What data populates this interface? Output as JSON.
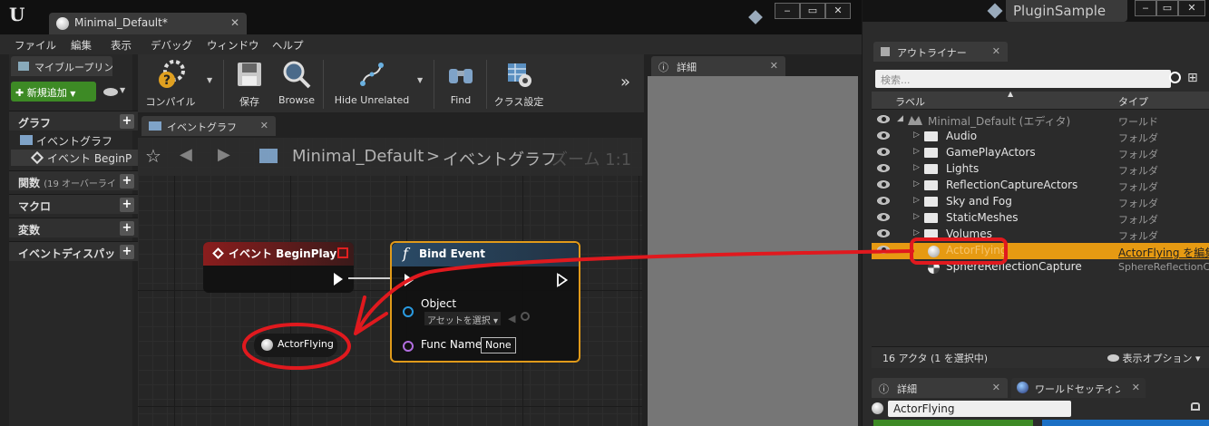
{
  "app": {
    "doc_tab": "Minimal_Default*",
    "project_name": "PluginSample",
    "window_controls": [
      "‒",
      "▭",
      "✕"
    ]
  },
  "menu": [
    "ファイル",
    "編集",
    "表示",
    "デバッグ",
    "ウィンドウ",
    "ヘルプ"
  ],
  "my_blueprint": {
    "tab": "マイブループリント",
    "add_button": "新規追加",
    "graph_section": "グラフ",
    "event_graph": "イベントグラフ",
    "event_beginplay": "イベント BeginP",
    "functions": "関数",
    "functions_note": "(19 オーバーライ",
    "macros": "マクロ",
    "variables": "変数",
    "dispatchers": "イベントディスパッ"
  },
  "toolbar": {
    "compile": "コンパイル",
    "save": "保存",
    "browse": "Browse",
    "hide_unrelated": "Hide Unrelated",
    "find": "Find",
    "class_settings": "クラス設定"
  },
  "graph": {
    "tab": "イベントグラフ",
    "breadcrumb_root": "Minimal_Default",
    "breadcrumb_sep": ">",
    "breadcrumb_current": "イベントグラフ",
    "zoom": "ズーム 1:1"
  },
  "details_left": {
    "tab": "詳細"
  },
  "nodes": {
    "begin_play": {
      "title": "イベント BeginPlay",
      "color": "#7a1a1a"
    },
    "bind_event": {
      "icon": "f",
      "title": "Bind Event",
      "object_label": "Object",
      "asset_select": "アセットを選択",
      "func_name_label": "Func Name",
      "func_name_value": "None",
      "color": "#2a4a66",
      "border": "#e09a1a"
    },
    "actor_ref": {
      "label": "ActorFlying"
    }
  },
  "outliner": {
    "tab": "アウトライナー",
    "search_placeholder": "検索...",
    "col_label": "ラベル",
    "col_type": "タイプ",
    "rows": [
      {
        "name": "Minimal_Default (エディタ)",
        "type": "ワールド"
      },
      {
        "name": "Audio",
        "type": "フォルダ"
      },
      {
        "name": "GamePlayActors",
        "type": "フォルダ"
      },
      {
        "name": "Lights",
        "type": "フォルダ"
      },
      {
        "name": "ReflectionCaptureActors",
        "type": "フォルダ"
      },
      {
        "name": "Sky and Fog",
        "type": "フォルダ"
      },
      {
        "name": "StaticMeshes",
        "type": "フォルダ"
      },
      {
        "name": "Volumes",
        "type": "フォルダ"
      },
      {
        "name": "ActorFlying",
        "type": "ActorFlying を編集"
      },
      {
        "name": "SphereReflectionCapture",
        "type": "SphereReflectionCa"
      }
    ],
    "status": "16 アクタ (1 を選択中)",
    "view_options": "表示オプション"
  },
  "details_right": {
    "tab": "詳細",
    "world_tab": "ワールドセッティング",
    "actor_name": "ActorFlying"
  },
  "annotation_color": "#e0191e"
}
